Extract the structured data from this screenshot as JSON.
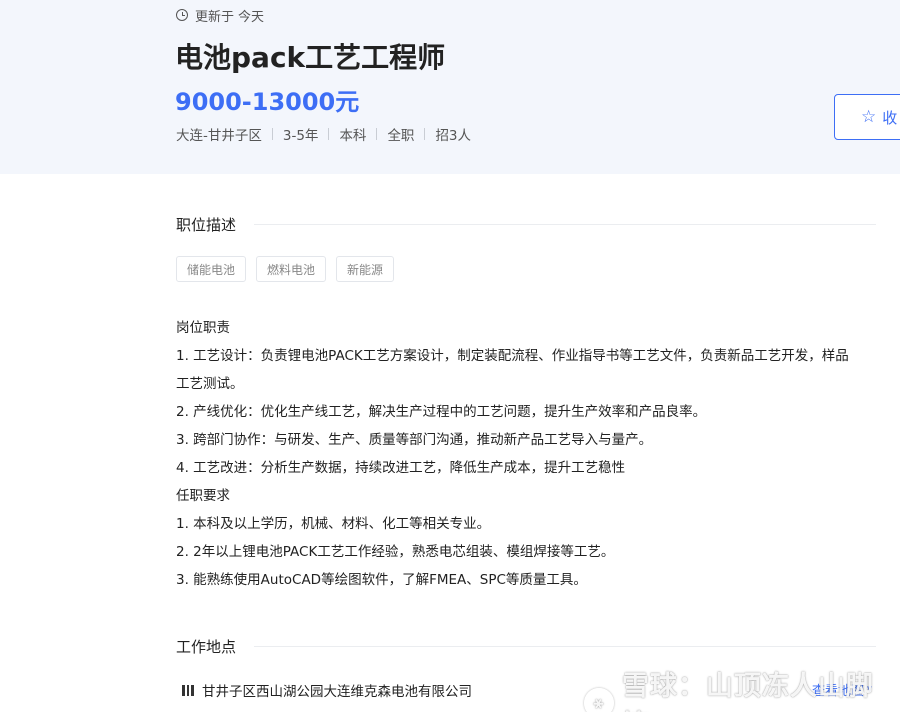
{
  "header": {
    "updated_label": "更新于",
    "updated_value": "今天",
    "job_title": "电池pack工艺工程师",
    "salary": "9000-13000元",
    "meta": [
      "大连-甘井子区",
      "3-5年",
      "本科",
      "全职",
      "招3人"
    ],
    "favorite_label": "收"
  },
  "description": {
    "title": "职位描述",
    "tags": [
      "储能电池",
      "燃料电池",
      "新能源"
    ],
    "lines": [
      "岗位职责",
      "1. 工艺设计：负责锂电池PACK工艺方案设计，制定装配流程、作业指导书等工艺文件，负责新品工艺开发，样品",
      "工艺测试。",
      "2. 产线优化：优化生产线工艺，解决生产过程中的工艺问题，提升生产效率和产品良率。",
      "3. 跨部门协作：与研发、生产、质量等部门沟通，推动新产品工艺导入与量产。",
      "4. 工艺改进：分析生产数据，持续改进工艺，降低生产成本，提升工艺稳性",
      "任职要求",
      "1. 本科及以上学历，机械、材料、化工等相关专业。",
      "2. 2年以上锂电池PACK工艺工作经验，熟悉电芯组装、模组焊接等工艺。",
      "3. 能熟练使用AutoCAD等绘图软件，了解FMEA、SPC等质量工具。"
    ]
  },
  "location": {
    "title": "工作地点",
    "address": "甘井子区西山湖公园大连维克森电池有限公司",
    "map_link": "查看地图"
  },
  "watermark": {
    "text": "雪球：山顶冻人山脚挖"
  },
  "colors": {
    "accent": "#3d6ef5",
    "header_bg": "#f3f6fc"
  }
}
